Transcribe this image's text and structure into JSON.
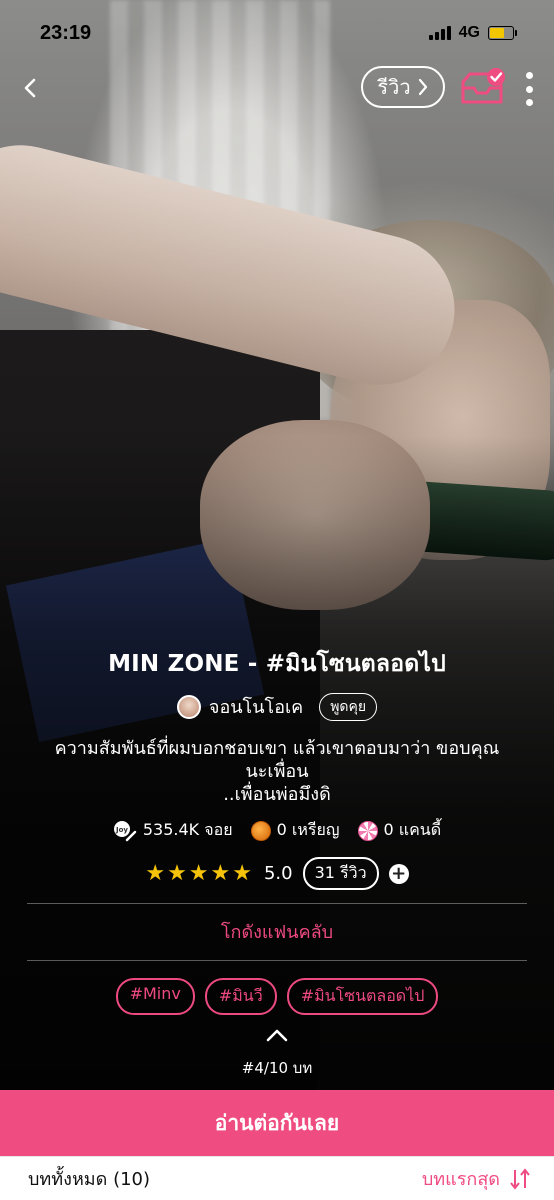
{
  "status_bar": {
    "time": "23:19",
    "network": "4G"
  },
  "nav": {
    "review_label": "รีวิว"
  },
  "story": {
    "title": "MIN ZONE - #มินโซนตลอดไป",
    "author": "จอนโนโอเค",
    "chat_label": "พูดคุย",
    "synopsis_line1": "ความสัมพันธ์ที่ผมบอกชอบเขา แล้วเขาตอบมาว่า ขอบคุณ",
    "synopsis_line2": "นะเพื่อน",
    "synopsis_line3": "..เพื่อนพ่อมึงดิ"
  },
  "stats": {
    "views": "535.4K จอย",
    "coins": "0 เหรียญ",
    "candies": "0 แคนดี้",
    "stars": "★★★★★",
    "rating": "5.0",
    "reviews": "31 รีวิว",
    "plus": "+"
  },
  "fanclub_label": "โกดังแฟนคลับ",
  "tags": [
    "#Minv",
    "#มินวี",
    "#มินโซนตลอดไป"
  ],
  "episode_indicator": "#4/10 บท",
  "read_button": "อ่านต่อกันเลย",
  "episodes": {
    "all_label": "บททั้งหมด (10)",
    "sort_label": "บทแรกสุด"
  },
  "colors": {
    "accent": "#ef4c82",
    "star": "#f5c40a"
  }
}
